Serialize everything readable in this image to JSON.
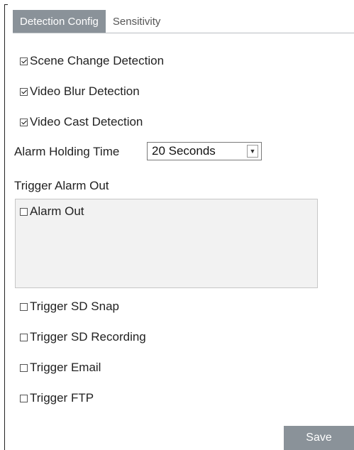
{
  "tabs": [
    {
      "label": "Detection Config"
    },
    {
      "label": "Sensitivity"
    }
  ],
  "options": {
    "scene_change": "Scene Change Detection",
    "video_blur": "Video Blur Detection",
    "video_cast": "Video Cast Detection"
  },
  "alarm_holding": {
    "label": "Alarm Holding Time",
    "value": "20 Seconds"
  },
  "trigger_alarm_out": {
    "label": "Trigger Alarm Out",
    "alarm_out": "Alarm Out"
  },
  "triggers": {
    "sd_snap": "Trigger SD Snap",
    "sd_recording": "Trigger SD Recording",
    "email": "Trigger Email",
    "ftp": "Trigger FTP"
  },
  "save_label": "Save"
}
